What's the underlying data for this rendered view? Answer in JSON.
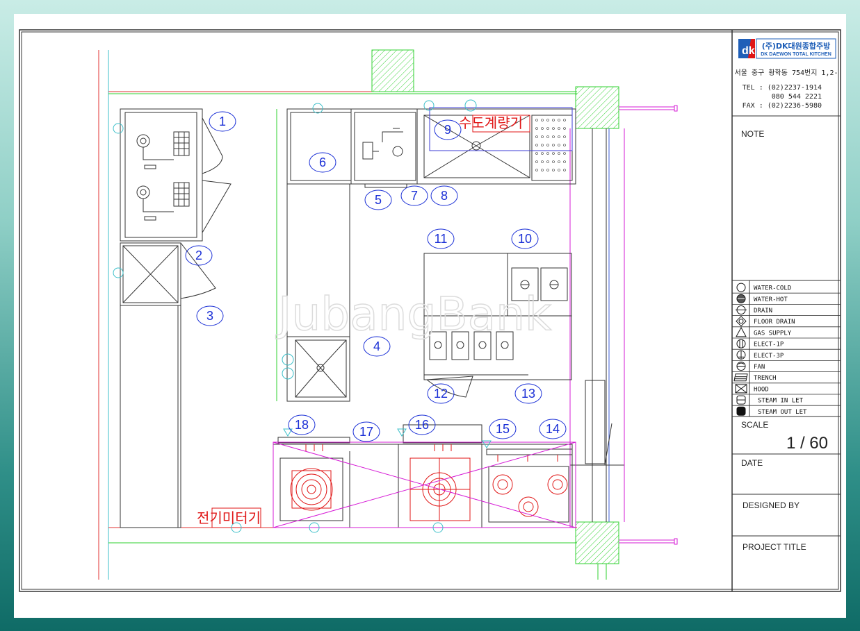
{
  "company": {
    "logo_text": "dk",
    "name_ko": "(주)DK대원종합주방",
    "name_en": "DK DAEWON TOTAL KITCHEN",
    "address": "서울 중구 황학동 754번지 1,2-",
    "tel": "TEL : (02)2237-1914",
    "tel2": "080  544  2221",
    "fax": "FAX : (02)2236-5980"
  },
  "title_block": {
    "note": "NOTE",
    "scale_label": "SCALE",
    "scale_value": "1 / 60",
    "date_label": "DATE",
    "designed_by_label": "DESIGNED BY",
    "project_title_label": "PROJECT TITLE"
  },
  "legend": [
    {
      "icon": "water-cold",
      "label": "WATER-COLD"
    },
    {
      "icon": "water-hot",
      "label": "WATER-HOT"
    },
    {
      "icon": "drain",
      "label": "DRAIN"
    },
    {
      "icon": "floor-drain",
      "label": "FLOOR DRAIN"
    },
    {
      "icon": "gas-supply",
      "label": "GAS SUPPLY"
    },
    {
      "icon": "elect-1p",
      "label": "ELECT-1P"
    },
    {
      "icon": "elect-3p",
      "label": "ELECT-3P"
    },
    {
      "icon": "fan",
      "label": "FAN"
    },
    {
      "icon": "trench",
      "label": "TRENCH"
    },
    {
      "icon": "hood",
      "label": "HOOD"
    },
    {
      "icon": "steam-in",
      "label": "STEAM IN LET"
    },
    {
      "icon": "steam-out",
      "label": "STEAM OUT LET"
    }
  ],
  "annotations": {
    "water_meter": "수도계량기",
    "electric_meter": "전기미터기"
  },
  "watermark": "JubangBank",
  "equipment_numbers": [
    "1",
    "2",
    "3",
    "4",
    "5",
    "6",
    "7",
    "8",
    "9",
    "10",
    "11",
    "12",
    "13",
    "14",
    "15",
    "16",
    "17",
    "18"
  ]
}
